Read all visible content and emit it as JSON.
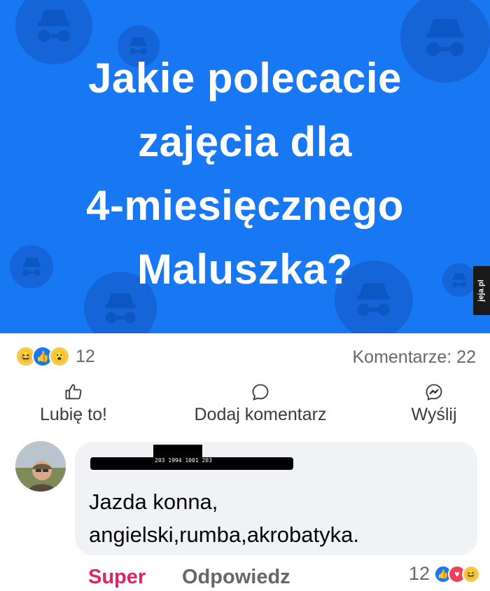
{
  "post": {
    "lines": [
      "Jakie polecacie",
      "zajęcia dla",
      "4-miesięcznego",
      "Maluszka?"
    ],
    "background_color": "#1877f2",
    "watermark": {
      "prefix": "jeja",
      "dot": ".",
      "suffix": "pl"
    }
  },
  "stats": {
    "reaction_icons": [
      "haha-emoji-icon",
      "like-icon",
      "wow-emoji-icon"
    ],
    "reaction_count": "12",
    "comments_label": "Komentarze: 22"
  },
  "actions": {
    "like": {
      "label": "Lubię to!",
      "icon": "thumbs-up-icon"
    },
    "comment": {
      "label": "Dodaj komentarz",
      "icon": "comment-bubble-icon"
    },
    "send": {
      "label": "Wyślij",
      "icon": "messenger-icon"
    }
  },
  "comment": {
    "author_scribble_text": "203 1994 1001 203",
    "text_lines": [
      "Jazda konna,",
      "angielski,rumba,akrobatyka."
    ],
    "reaction_label": "Super",
    "reply_label": "Odpowiedz",
    "reaction_count": "12",
    "reaction_icons": [
      "like-icon",
      "love-icon",
      "haha-emoji-icon"
    ]
  }
}
